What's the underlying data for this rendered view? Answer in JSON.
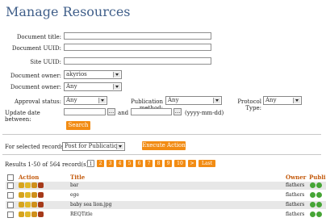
{
  "page": {
    "title": "Manage Resources"
  },
  "form": {
    "doc_title_label": "Document title:",
    "doc_uuid_label": "Document UUID:",
    "site_uuid_label": "Site UUID:",
    "doc_owner_label": "Document owner:",
    "doc_owner_value": "akyrios",
    "doc_owner2_label": "Document owner:",
    "doc_owner2_value": "Any",
    "approval_label": "Approval status:",
    "approval_value": "Any",
    "pubmethod_label": "Publication method:",
    "pubmethod_value": "Any",
    "prottype_label": "Protocol Type:",
    "prottype_value": "Any",
    "update_label": "Update date between:",
    "and_label": "and",
    "date_hint": "(yyyy-mm-dd)",
    "search_label": "Search"
  },
  "bulk": {
    "label": "For selected records:",
    "value": "Post for Publication",
    "execute_label": "Execute Action"
  },
  "results": {
    "text": "Results 1-50 of 564 record(s)",
    "pages": [
      "1",
      "2",
      "3",
      "4",
      "5",
      "6",
      "7",
      "8",
      "9",
      "10",
      ">",
      "Last"
    ]
  },
  "table": {
    "headers": {
      "action": "Action",
      "title": "Title",
      "owner": "Owner",
      "pub": "Publi"
    },
    "rows": [
      {
        "title": "bar",
        "owner": "flathers"
      },
      {
        "title": "ege",
        "owner": "flathers"
      },
      {
        "title": "baby sea lion.jpg",
        "owner": "flathers"
      },
      {
        "title": "REQTitle",
        "owner": "flathers"
      }
    ]
  }
}
